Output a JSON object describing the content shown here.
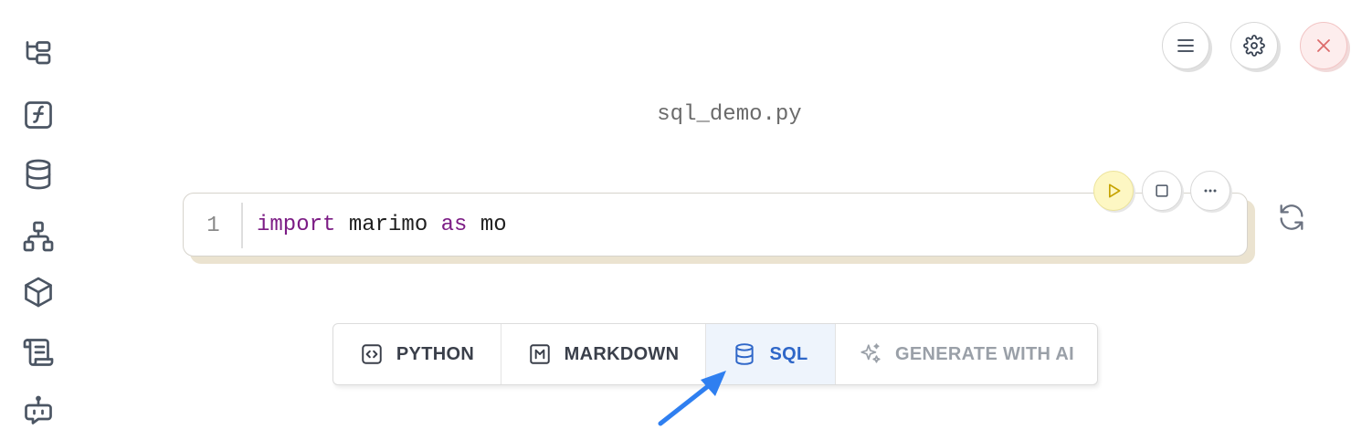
{
  "notebook": {
    "filename": "sql_demo.py"
  },
  "sidebar": {
    "items": [
      {
        "icon": "file-tree-icon"
      },
      {
        "icon": "function-icon"
      },
      {
        "icon": "database-icon"
      },
      {
        "icon": "dependency-graph-icon"
      },
      {
        "icon": "package-icon"
      },
      {
        "icon": "scroll-icon"
      },
      {
        "icon": "bot-icon"
      }
    ]
  },
  "header": {
    "menu_icon": "hamburger-menu-icon",
    "settings_icon": "gear-icon",
    "close_icon": "close-icon"
  },
  "cell": {
    "line_number": "1",
    "code": {
      "kw1": "import",
      "t1": " marimo ",
      "kw2": "as",
      "t2": " mo"
    }
  },
  "add_cell_bar": {
    "python_label": "PYTHON",
    "markdown_label": "MARKDOWN",
    "sql_label": "SQL",
    "ai_label": "GENERATE WITH AI"
  },
  "colors": {
    "accent": "#2e66c8",
    "keyword": "#7c1c85",
    "run_button": "#fdf7c3",
    "arrow": "#2f7ff0"
  }
}
